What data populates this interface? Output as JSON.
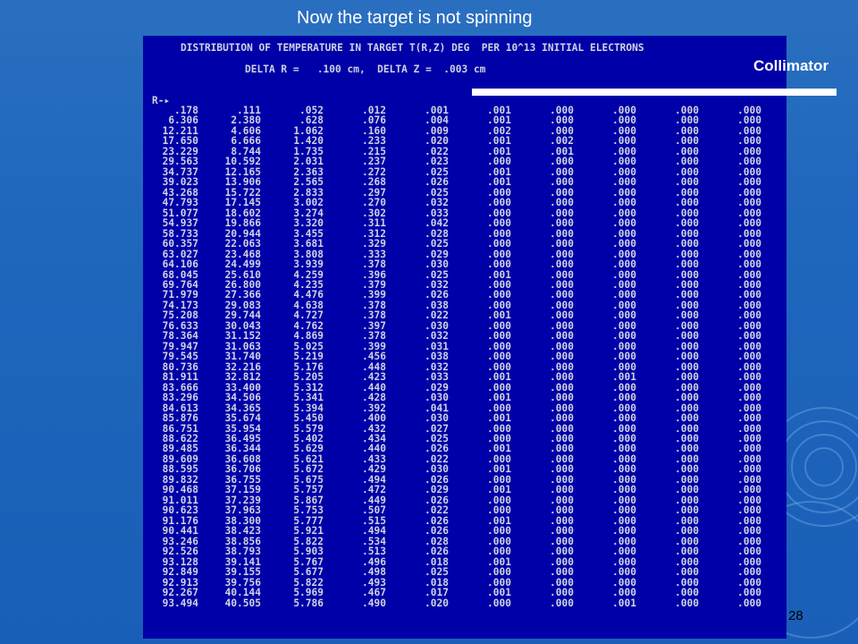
{
  "slide": {
    "title": "Now the target is not spinning",
    "page_number": "28"
  },
  "annotation": {
    "collimator_label": "Collimator"
  },
  "terminal": {
    "header_line1": "DISTRIBUTION OF TEMPERATURE IN TARGET T(R,Z) DEG  PER 10^13 INITIAL ELECTRONS",
    "header_line2": "DELTA R =   .100 cm,  DELTA Z =  .003 cm",
    "r_axis_label": "R-",
    "arrow_glyph": "▸",
    "rows": [
      [
        ".178",
        ".111",
        ".052",
        ".012",
        ".001",
        ".001",
        ".000",
        ".000",
        ".000",
        ".000"
      ],
      [
        "6.306",
        "2.380",
        ".628",
        ".076",
        ".004",
        ".001",
        ".000",
        ".000",
        ".000",
        ".000"
      ],
      [
        "12.211",
        "4.606",
        "1.062",
        ".160",
        ".009",
        ".002",
        ".000",
        ".000",
        ".000",
        ".000"
      ],
      [
        "17.650",
        "6.666",
        "1.420",
        ".233",
        ".020",
        ".001",
        ".002",
        ".000",
        ".000",
        ".000"
      ],
      [
        "23.229",
        "8.744",
        "1.735",
        ".215",
        ".022",
        ".001",
        ".001",
        ".000",
        ".000",
        ".000"
      ],
      [
        "29.563",
        "10.592",
        "2.031",
        ".237",
        ".023",
        ".000",
        ".000",
        ".000",
        ".000",
        ".000"
      ],
      [
        "34.737",
        "12.165",
        "2.363",
        ".272",
        ".025",
        ".001",
        ".000",
        ".000",
        ".000",
        ".000"
      ],
      [
        "39.023",
        "13.906",
        "2.565",
        ".268",
        ".026",
        ".001",
        ".000",
        ".000",
        ".000",
        ".000"
      ],
      [
        "43.268",
        "15.722",
        "2.833",
        ".297",
        ".025",
        ".000",
        ".000",
        ".000",
        ".000",
        ".000"
      ],
      [
        "47.793",
        "17.145",
        "3.002",
        ".270",
        ".032",
        ".000",
        ".000",
        ".000",
        ".000",
        ".000"
      ],
      [
        "51.077",
        "18.602",
        "3.274",
        ".302",
        ".033",
        ".000",
        ".000",
        ".000",
        ".000",
        ".000"
      ],
      [
        "54.937",
        "19.866",
        "3.320",
        ".311",
        ".042",
        ".000",
        ".000",
        ".000",
        ".000",
        ".000"
      ],
      [
        "58.733",
        "20.944",
        "3.455",
        ".312",
        ".028",
        ".000",
        ".000",
        ".000",
        ".000",
        ".000"
      ],
      [
        "60.357",
        "22.063",
        "3.681",
        ".329",
        ".025",
        ".000",
        ".000",
        ".000",
        ".000",
        ".000"
      ],
      [
        "63.027",
        "23.468",
        "3.808",
        ".333",
        ".029",
        ".000",
        ".000",
        ".000",
        ".000",
        ".000"
      ],
      [
        "64.106",
        "24.499",
        "3.939",
        ".378",
        ".030",
        ".000",
        ".000",
        ".000",
        ".000",
        ".000"
      ],
      [
        "68.045",
        "25.610",
        "4.259",
        ".396",
        ".025",
        ".001",
        ".000",
        ".000",
        ".000",
        ".000"
      ],
      [
        "69.764",
        "26.800",
        "4.235",
        ".379",
        ".032",
        ".000",
        ".000",
        ".000",
        ".000",
        ".000"
      ],
      [
        "71.979",
        "27.366",
        "4.476",
        ".399",
        ".026",
        ".000",
        ".000",
        ".000",
        ".000",
        ".000"
      ],
      [
        "74.173",
        "29.083",
        "4.638",
        ".378",
        ".038",
        ".000",
        ".000",
        ".000",
        ".000",
        ".000"
      ],
      [
        "75.208",
        "29.744",
        "4.727",
        ".378",
        ".022",
        ".001",
        ".000",
        ".000",
        ".000",
        ".000"
      ],
      [
        "76.633",
        "30.043",
        "4.762",
        ".397",
        ".030",
        ".000",
        ".000",
        ".000",
        ".000",
        ".000"
      ],
      [
        "78.364",
        "31.152",
        "4.869",
        ".378",
        ".032",
        ".000",
        ".000",
        ".000",
        ".000",
        ".000"
      ],
      [
        "79.947",
        "31.063",
        "5.025",
        ".399",
        ".031",
        ".000",
        ".000",
        ".000",
        ".000",
        ".000"
      ],
      [
        "79.545",
        "31.740",
        "5.219",
        ".456",
        ".038",
        ".000",
        ".000",
        ".000",
        ".000",
        ".000"
      ],
      [
        "80.736",
        "32.216",
        "5.176",
        ".448",
        ".032",
        ".000",
        ".000",
        ".000",
        ".000",
        ".000"
      ],
      [
        "81.911",
        "32.812",
        "5.205",
        ".423",
        ".033",
        ".001",
        ".000",
        ".001",
        ".000",
        ".000"
      ],
      [
        "83.666",
        "33.400",
        "5.312",
        ".440",
        ".029",
        ".000",
        ".000",
        ".000",
        ".000",
        ".000"
      ],
      [
        "83.296",
        "34.506",
        "5.341",
        ".428",
        ".030",
        ".001",
        ".000",
        ".000",
        ".000",
        ".000"
      ],
      [
        "84.613",
        "34.365",
        "5.394",
        ".392",
        ".041",
        ".000",
        ".000",
        ".000",
        ".000",
        ".000"
      ],
      [
        "85.876",
        "35.674",
        "5.450",
        ".400",
        ".030",
        ".001",
        ".000",
        ".000",
        ".000",
        ".000"
      ],
      [
        "86.751",
        "35.954",
        "5.579",
        ".432",
        ".027",
        ".000",
        ".000",
        ".000",
        ".000",
        ".000"
      ],
      [
        "88.622",
        "36.495",
        "5.402",
        ".434",
        ".025",
        ".000",
        ".000",
        ".000",
        ".000",
        ".000"
      ],
      [
        "89.485",
        "36.344",
        "5.629",
        ".440",
        ".026",
        ".001",
        ".000",
        ".000",
        ".000",
        ".000"
      ],
      [
        "89.609",
        "36.608",
        "5.621",
        ".433",
        ".022",
        ".000",
        ".000",
        ".000",
        ".000",
        ".000"
      ],
      [
        "88.595",
        "36.706",
        "5.672",
        ".429",
        ".030",
        ".001",
        ".000",
        ".000",
        ".000",
        ".000"
      ],
      [
        "89.832",
        "36.755",
        "5.675",
        ".494",
        ".026",
        ".000",
        ".000",
        ".000",
        ".000",
        ".000"
      ],
      [
        "90.468",
        "37.159",
        "5.757",
        ".472",
        ".029",
        ".001",
        ".000",
        ".000",
        ".000",
        ".000"
      ],
      [
        "91.011",
        "37.239",
        "5.867",
        ".449",
        ".026",
        ".000",
        ".000",
        ".000",
        ".000",
        ".000"
      ],
      [
        "90.623",
        "37.963",
        "5.753",
        ".507",
        ".022",
        ".000",
        ".000",
        ".000",
        ".000",
        ".000"
      ],
      [
        "91.176",
        "38.300",
        "5.777",
        ".515",
        ".026",
        ".001",
        ".000",
        ".000",
        ".000",
        ".000"
      ],
      [
        "90.441",
        "38.423",
        "5.921",
        ".494",
        ".026",
        ".000",
        ".000",
        ".000",
        ".000",
        ".000"
      ],
      [
        "93.246",
        "38.856",
        "5.822",
        ".534",
        ".028",
        ".000",
        ".000",
        ".000",
        ".000",
        ".000"
      ],
      [
        "92.526",
        "38.793",
        "5.903",
        ".513",
        ".026",
        ".000",
        ".000",
        ".000",
        ".000",
        ".000"
      ],
      [
        "93.128",
        "39.141",
        "5.767",
        ".496",
        ".018",
        ".001",
        ".000",
        ".000",
        ".000",
        ".000"
      ],
      [
        "92.849",
        "39.155",
        "5.677",
        ".498",
        ".025",
        ".000",
        ".000",
        ".000",
        ".000",
        ".000"
      ],
      [
        "92.913",
        "39.756",
        "5.822",
        ".493",
        ".018",
        ".000",
        ".000",
        ".000",
        ".000",
        ".000"
      ],
      [
        "92.267",
        "40.144",
        "5.969",
        ".467",
        ".017",
        ".001",
        ".000",
        ".000",
        ".000",
        ".000"
      ],
      [
        "93.494",
        "40.505",
        "5.786",
        ".490",
        ".020",
        ".000",
        ".000",
        ".001",
        ".000",
        ".000"
      ]
    ]
  },
  "colors": {
    "background": "#1f66bd",
    "terminal_background": "#0000a8",
    "terminal_text": "#cfd3e0",
    "collimator_marker": "#ffffff"
  }
}
